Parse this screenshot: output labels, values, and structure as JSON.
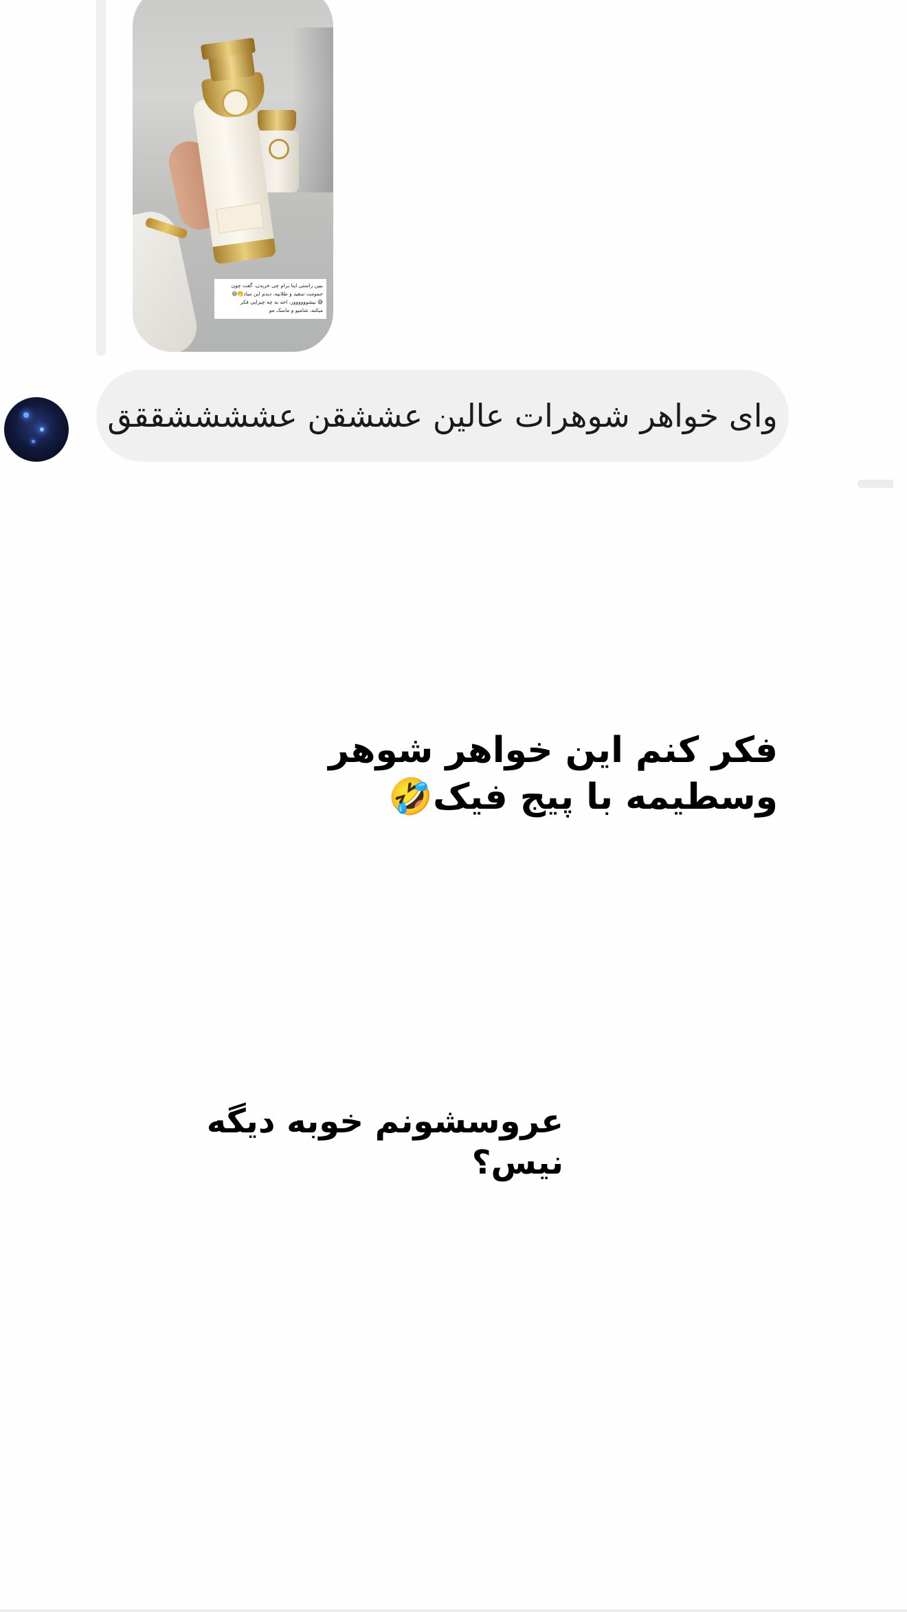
{
  "story_reply": {
    "caption_lines": [
      "ببین راستی اینا برام چی خریدن، گفت چون",
      "حمومت سفید و طلاییه، دیدم این میاد🤭😅",
      "😅 بیشوووووور، اخه به چه چیزایی فکر",
      "میکنه، شامپو و ماسک مو"
    ]
  },
  "message": {
    "text": "وای خواهر شوهرات عالین عششقن عششششققق"
  },
  "overlay": {
    "line1": "فکر کنم این خواهر شوهر",
    "line2": "وسطیمه با پیج فیک🤣",
    "line3": "عروسشونم خوبه دیگه نیس؟"
  },
  "colors": {
    "bubble_bg": "#f0f0f1",
    "page_bg": "#fefefe",
    "reply_bar": "#efefef"
  }
}
